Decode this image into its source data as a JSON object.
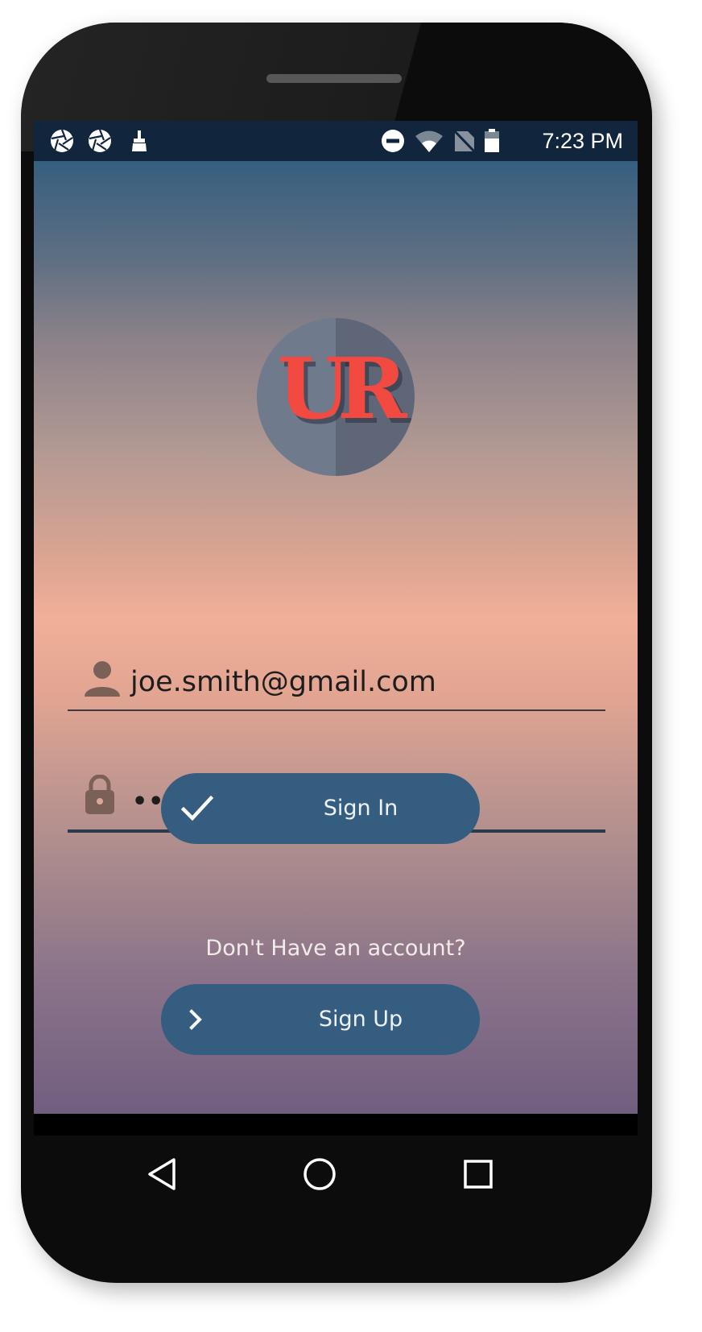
{
  "status_bar": {
    "left_icons": [
      "aperture-icon",
      "aperture-icon",
      "cleaner-brush-icon"
    ],
    "right_icons": [
      "do-not-disturb-icon",
      "wifi-icon",
      "no-sim-icon",
      "battery-icon"
    ],
    "time": "7:23 PM"
  },
  "logo": {
    "text": "UR",
    "accent_color": "#f24a41"
  },
  "login": {
    "email_value": "joe.smith@gmail.com",
    "email_icon": "person-icon",
    "password_value": "••••••",
    "password_icon": "lock-icon"
  },
  "buttons": {
    "sign_in_label": "Sign In",
    "sign_in_icon": "check-icon",
    "prompt": "Don't Have an account?",
    "sign_up_label": "Sign Up",
    "sign_up_icon": "chevron-right-icon"
  },
  "nav": {
    "items": [
      "back-icon",
      "home-icon",
      "recents-icon"
    ]
  },
  "colors": {
    "button": "#355d80",
    "status_bar": "#11253d",
    "gradient_top": "#365f80",
    "gradient_mid": "#f0b098",
    "gradient_bottom": "#715e80"
  }
}
